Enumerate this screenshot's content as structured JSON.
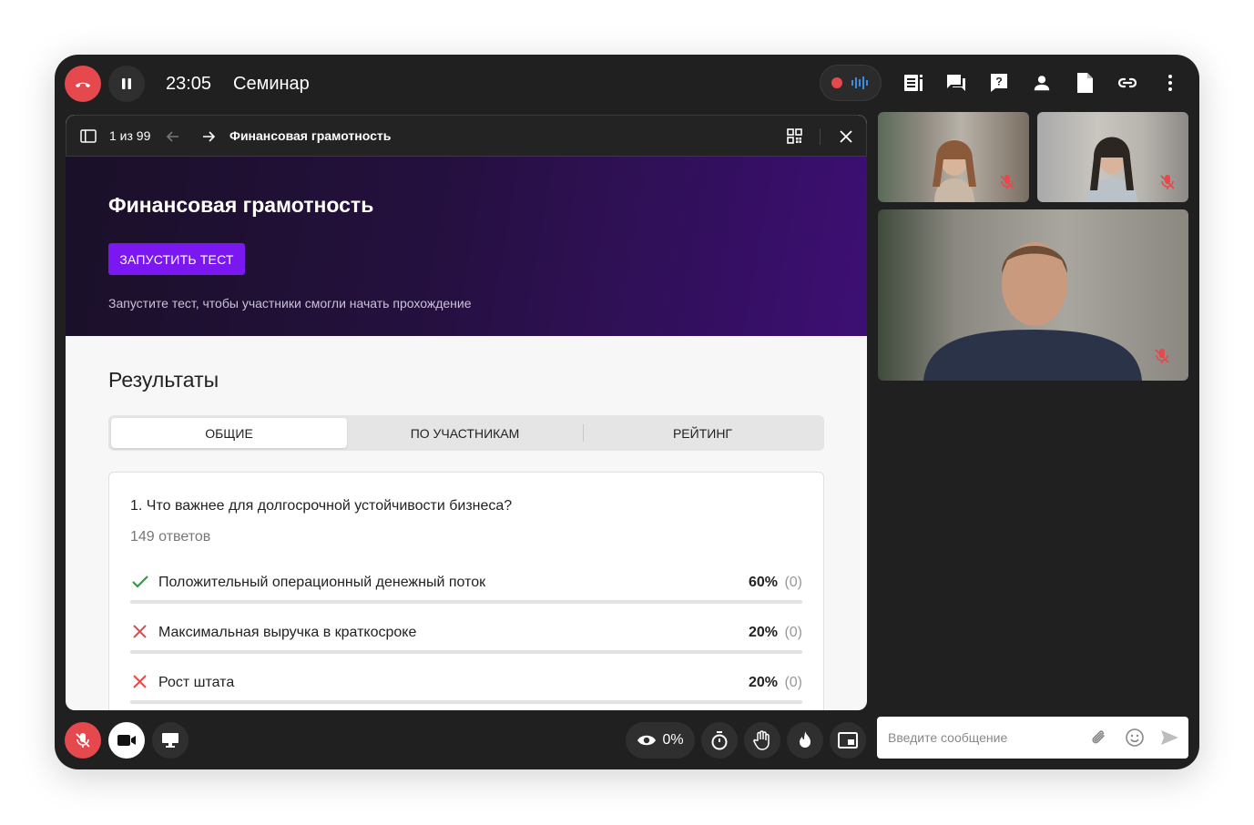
{
  "header": {
    "time": "23:05",
    "title": "Семинар"
  },
  "presentation": {
    "page_counter": "1 из 99",
    "doc_title": "Финансовая грамотность",
    "hero_title": "Финансовая грамотность",
    "start_button": "ЗАПУСТИТЬ ТЕСТ",
    "hint": "Запустите тест, чтобы участники смогли начать прохождение",
    "results_title": "Результаты",
    "tabs": [
      {
        "label": "ОБЩИЕ",
        "active": true
      },
      {
        "label": "ПО УЧАСТНИКАМ",
        "active": false
      },
      {
        "label": "РЕЙТИНГ",
        "active": false
      }
    ],
    "question": {
      "title": "1. Что важнее для долгосрочной устойчивости бизнеса?",
      "count": "149 ответов",
      "answers": [
        {
          "label": "Положительный операционный денежный поток",
          "correct": true,
          "percent": "60%",
          "count": "(0)"
        },
        {
          "label": "Максимальная выручка в краткосроке",
          "correct": false,
          "percent": "20%",
          "count": "(0)"
        },
        {
          "label": "Рост штата",
          "correct": false,
          "percent": "20%",
          "count": "(0)"
        }
      ]
    }
  },
  "controls": {
    "views_percent": "0%"
  },
  "chat": {
    "placeholder": "Введите сообщение"
  },
  "colors": {
    "danger": "#e5484d",
    "accent": "#7b18f2",
    "correct": "#2e9e44",
    "wrong": "#e5484d"
  },
  "icons": {
    "top_tools": [
      "notes-icon",
      "chat-icon",
      "question-icon",
      "participants-icon",
      "document-icon",
      "link-icon",
      "more-icon"
    ],
    "bottom_tools": [
      "microphone-off-icon",
      "camera-icon",
      "screen-share-icon",
      "eye-icon",
      "timer-icon",
      "raise-hand-icon",
      "fire-icon",
      "picture-in-picture-icon"
    ]
  }
}
